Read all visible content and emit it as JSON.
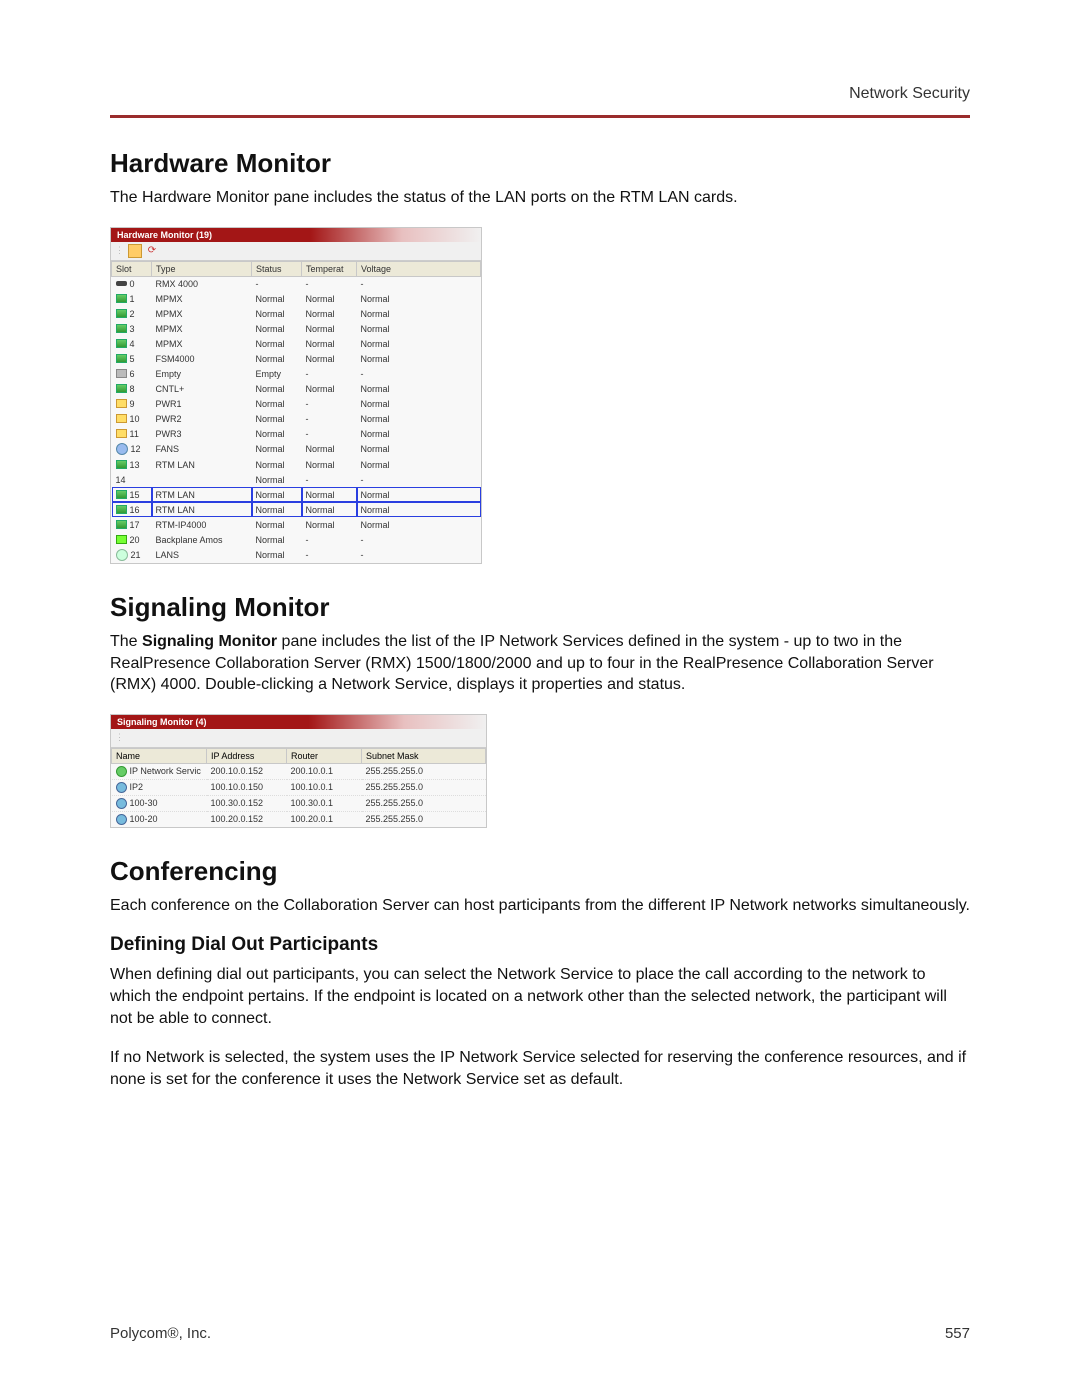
{
  "header": {
    "label": "Network Security"
  },
  "hardware_monitor": {
    "title": "Hardware Monitor",
    "intro": "The Hardware Monitor pane includes the status of the LAN ports on the RTM LAN cards.",
    "panel_title": "Hardware Monitor (19)",
    "columns": {
      "slot": "Slot",
      "type": "Type",
      "status": "Status",
      "temperature": "Temperat",
      "voltage": "Voltage"
    },
    "rows": [
      {
        "icon": "flat",
        "slot": "0",
        "type": "RMX 4000",
        "status": "-",
        "temp": "-",
        "volt": "-",
        "hl": false
      },
      {
        "icon": "green",
        "slot": "1",
        "type": "MPMX",
        "status": "Normal",
        "temp": "Normal",
        "volt": "Normal",
        "hl": false
      },
      {
        "icon": "green",
        "slot": "2",
        "type": "MPMX",
        "status": "Normal",
        "temp": "Normal",
        "volt": "Normal",
        "hl": false
      },
      {
        "icon": "green",
        "slot": "3",
        "type": "MPMX",
        "status": "Normal",
        "temp": "Normal",
        "volt": "Normal",
        "hl": false
      },
      {
        "icon": "green",
        "slot": "4",
        "type": "MPMX",
        "status": "Normal",
        "temp": "Normal",
        "volt": "Normal",
        "hl": false
      },
      {
        "icon": "green",
        "slot": "5",
        "type": "FSM4000",
        "status": "Normal",
        "temp": "Normal",
        "volt": "Normal",
        "hl": false
      },
      {
        "icon": "gray",
        "slot": "6",
        "type": "Empty",
        "status": "Empty",
        "temp": "-",
        "volt": "-",
        "hl": false
      },
      {
        "icon": "green",
        "slot": "8",
        "type": "CNTL+",
        "status": "Normal",
        "temp": "Normal",
        "volt": "Normal",
        "hl": false
      },
      {
        "icon": "yel",
        "slot": "9",
        "type": "PWR1",
        "status": "Normal",
        "temp": "-",
        "volt": "Normal",
        "hl": false
      },
      {
        "icon": "yel",
        "slot": "10",
        "type": "PWR2",
        "status": "Normal",
        "temp": "-",
        "volt": "Normal",
        "hl": false
      },
      {
        "icon": "yel",
        "slot": "11",
        "type": "PWR3",
        "status": "Normal",
        "temp": "-",
        "volt": "Normal",
        "hl": false
      },
      {
        "icon": "fan",
        "slot": "12",
        "type": "FANS",
        "status": "Normal",
        "temp": "Normal",
        "volt": "Normal",
        "hl": false
      },
      {
        "icon": "green",
        "slot": "13",
        "type": "RTM LAN",
        "status": "Normal",
        "temp": "Normal",
        "volt": "Normal",
        "hl": false
      },
      {
        "icon": "",
        "slot": "14",
        "type": "",
        "status": "Normal",
        "temp": "-",
        "volt": "-",
        "hl": false
      },
      {
        "icon": "green",
        "slot": "15",
        "type": "RTM LAN",
        "status": "Normal",
        "temp": "Normal",
        "volt": "Normal",
        "hl": true
      },
      {
        "icon": "green",
        "slot": "16",
        "type": "RTM LAN",
        "status": "Normal",
        "temp": "Normal",
        "volt": "Normal",
        "hl": true
      },
      {
        "icon": "green",
        "slot": "17",
        "type": "RTM-IP4000",
        "status": "Normal",
        "temp": "Normal",
        "volt": "Normal",
        "hl": false
      },
      {
        "icon": "lime",
        "slot": "20",
        "type": "Backplane Amos",
        "status": "Normal",
        "temp": "-",
        "volt": "-",
        "hl": false
      },
      {
        "icon": "net",
        "slot": "21",
        "type": "LANS",
        "status": "Normal",
        "temp": "-",
        "volt": "-",
        "hl": false
      }
    ]
  },
  "signaling_monitor": {
    "title": "Signaling Monitor",
    "intro_pre": "The ",
    "intro_bold": "Signaling Monitor",
    "intro_post": " pane includes the list of the IP Network Services defined in the system - up to two in the RealPresence Collaboration Server (RMX) 1500/1800/2000 and up to four in the RealPresence Collaboration Server (RMX) 4000. Double-clicking a Network Service, displays it properties and status.",
    "panel_title": "Signaling Monitor (4)",
    "columns": {
      "name": "Name",
      "ip": "IP Address",
      "router": "Router",
      "subnet": "Subnet Mask"
    },
    "rows": [
      {
        "icon": "grn",
        "name": "IP Network Servic",
        "ip": "200.10.0.152",
        "router": "200.10.0.1",
        "subnet": "255.255.255.0"
      },
      {
        "icon": "blue",
        "name": "IP2",
        "ip": "100.10.0.150",
        "router": "100.10.0.1",
        "subnet": "255.255.255.0"
      },
      {
        "icon": "blue",
        "name": "100-30",
        "ip": "100.30.0.152",
        "router": "100.30.0.1",
        "subnet": "255.255.255.0"
      },
      {
        "icon": "blue",
        "name": "100-20",
        "ip": "100.20.0.152",
        "router": "100.20.0.1",
        "subnet": "255.255.255.0"
      }
    ]
  },
  "conferencing": {
    "title": "Conferencing",
    "intro": "Each conference on the Collaboration Server can host participants from the different IP Network networks simultaneously.",
    "sub_title": "Defining Dial Out Participants",
    "p1": "When defining dial out participants, you can select the Network Service to place the call according to the network to which the endpoint pertains. If the endpoint is located on a network other than the selected network, the participant will not be able to connect.",
    "p2": "If no Network is selected, the system uses the IP Network Service selected for reserving the conference resources, and if none is set for the conference it uses the Network Service set as default."
  },
  "footer": {
    "left": "Polycom®, Inc.",
    "right": "557"
  }
}
